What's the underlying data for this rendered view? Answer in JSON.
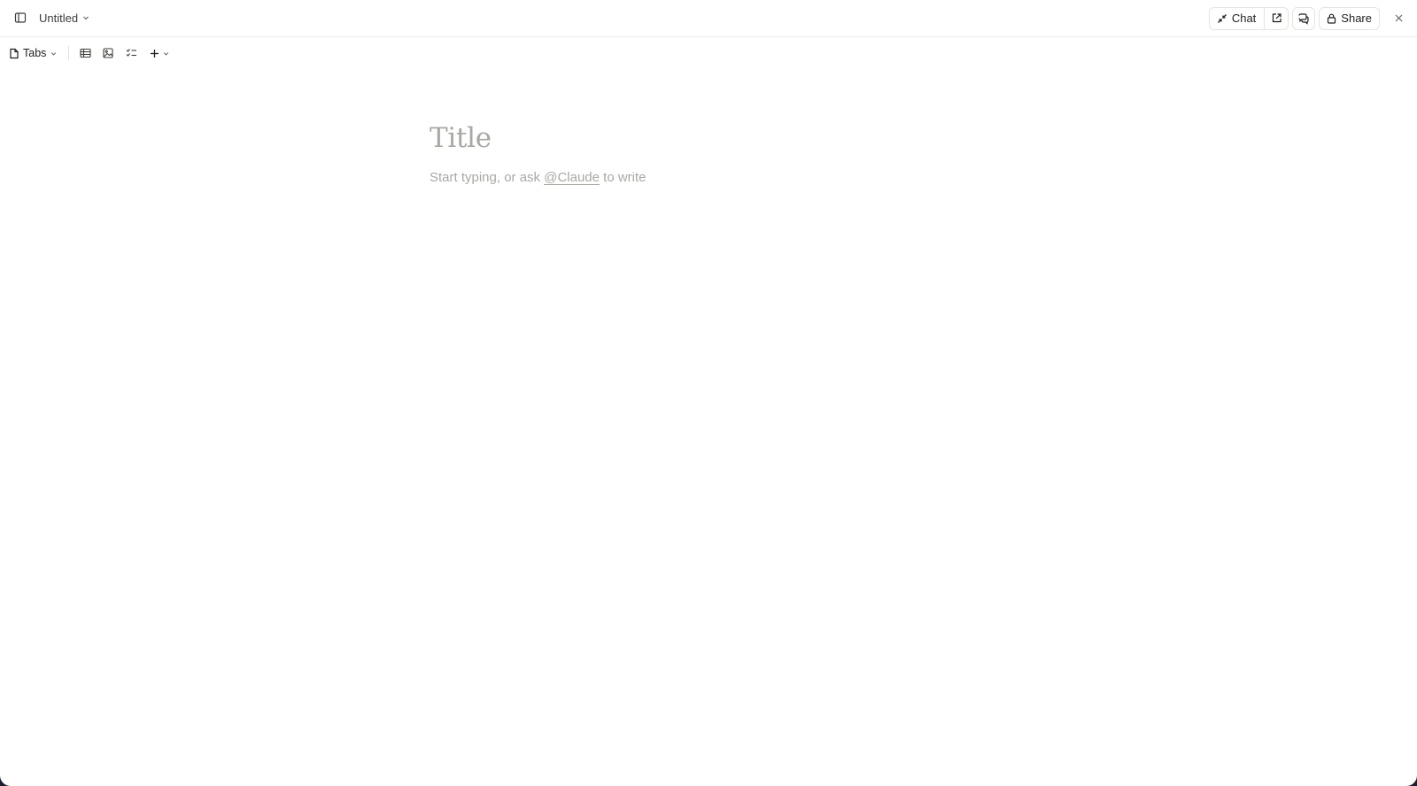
{
  "header": {
    "doc_title": "Untitled",
    "chat_label": "Chat",
    "share_label": "Share"
  },
  "toolbar": {
    "tabs_label": "Tabs"
  },
  "editor": {
    "title_placeholder": "Title",
    "body_prefix": "Start typing, or ask ",
    "body_mention": "@Claude",
    "body_suffix": " to write"
  },
  "icons": {
    "sidebar": "sidebar-toggle-icon",
    "chevron": "chevron-down-icon",
    "collapse": "collapse-arrows-icon",
    "external": "external-link-icon",
    "comments": "comments-icon",
    "lock": "lock-icon",
    "close": "close-icon",
    "document": "document-icon",
    "table": "table-icon",
    "image": "image-icon",
    "checklist": "checklist-icon",
    "plus": "plus-icon"
  },
  "colors": {
    "text": "#1f1f1e",
    "placeholder": "#a9a8a3",
    "border": "#e6e4df"
  }
}
